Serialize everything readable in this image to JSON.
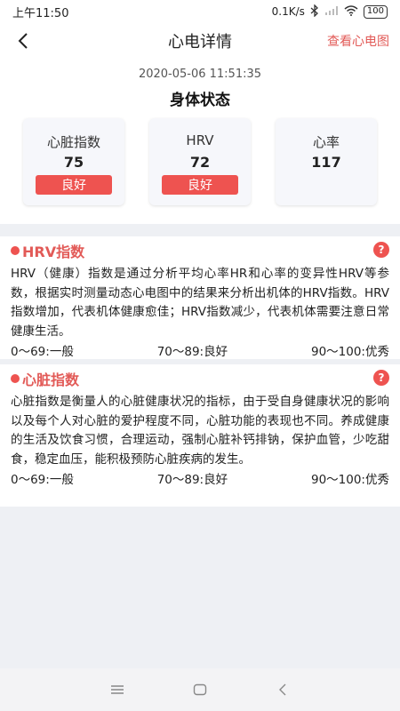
{
  "status_bar": {
    "time": "上午11:50",
    "net_speed": "0.1K/s",
    "battery": "100"
  },
  "nav": {
    "title": "心电详情",
    "right_link": "查看心电图"
  },
  "summary": {
    "timestamp": "2020-05-06 11:51:35",
    "title": "身体状态",
    "metrics": [
      {
        "label": "心脏指数",
        "value": "75",
        "badge": "良好"
      },
      {
        "label": "HRV",
        "value": "72",
        "badge": "良好"
      },
      {
        "label": "心率",
        "value": "117",
        "badge": ""
      }
    ]
  },
  "sections": [
    {
      "title": "HRV指数",
      "text": "HRV（健康）指数是通过分析平均心率HR和心率的变异性HRV等参数，根据实时测量动态心电图中的结果来分析出机体的HRV指数。HRV指数增加，代表机体健康愈佳；HRV指数减少，代表机体需要注意日常健康生活。",
      "ranges": [
        "0～69:一般",
        "70～89:良好",
        "90～100:优秀"
      ],
      "help": "?"
    },
    {
      "title": "心脏指数",
      "text": "心脏指数是衡量人的心脏健康状况的指标，由于受自身健康状况的影响以及每个人对心脏的爱护程度不同，心脏功能的表现也不同。养成健康的生活及饮食习惯，合理运动，强制心脏补钙排钠，保护血管，少吃甜食，稳定血压，能积极预防心脏疾病的发生。",
      "ranges": [
        "0～69:一般",
        "70～89:良好",
        "90～100:优秀"
      ],
      "help": "?"
    }
  ],
  "colors": {
    "accent": "#ee5350",
    "accent_text": "#e25a57",
    "background": "#eef0f4"
  }
}
